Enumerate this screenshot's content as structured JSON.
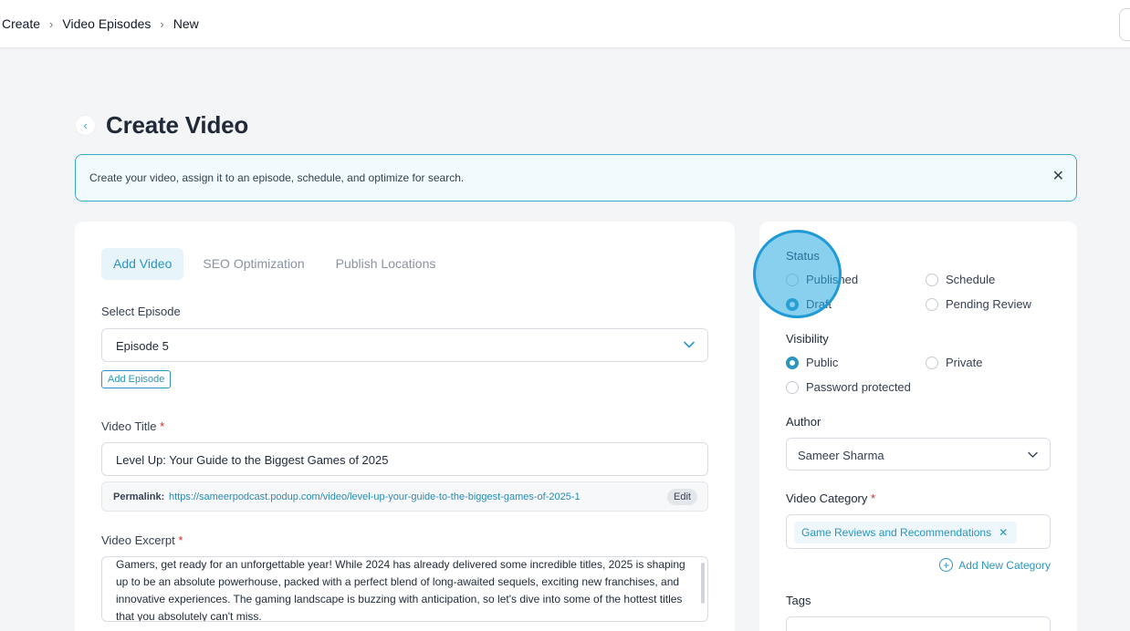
{
  "breadcrumb": [
    "Create",
    "Video Episodes",
    "New"
  ],
  "page": {
    "title": "Create Video",
    "info": "Create your video, assign it to an episode, schedule, and optimize for search."
  },
  "tabs": [
    {
      "label": "Add Video",
      "active": true
    },
    {
      "label": "SEO Optimization",
      "active": false
    },
    {
      "label": "Publish Locations",
      "active": false
    }
  ],
  "episode": {
    "label": "Select Episode",
    "value": "Episode 5",
    "add_button": "Add Episode"
  },
  "video_title": {
    "label": "Video Title",
    "value": "Level Up: Your Guide to the Biggest Games of 2025",
    "permalink_label": "Permalink:",
    "permalink_url": "https://sameerpodcast.podup.com/video/level-up-your-guide-to-the-biggest-games-of-2025-1",
    "edit_label": "Edit"
  },
  "excerpt": {
    "label": "Video Excerpt",
    "value": "Gamers, get ready for an unforgettable year! While 2024 has already delivered some incredible titles, 2025 is shaping up to be an absolute powerhouse, packed with a perfect blend of long-awaited sequels, exciting new franchises, and innovative experiences. The gaming landscape is buzzing with anticipation, so let's dive into some of the hottest titles that you absolutely can't miss."
  },
  "status": {
    "label": "Status",
    "options": [
      "Published",
      "Schedule",
      "Draft",
      "Pending Review"
    ],
    "selected": "Draft"
  },
  "visibility": {
    "label": "Visibility",
    "options": [
      "Public",
      "Private",
      "Password protected"
    ],
    "selected": "Public"
  },
  "author": {
    "label": "Author",
    "value": "Sameer Sharma"
  },
  "category": {
    "label": "Video Category",
    "chip": "Game Reviews and Recommendations",
    "add_label": "Add New Category"
  },
  "tags": {
    "label": "Tags"
  },
  "colors": {
    "accent": "#2b96c0",
    "required": "#dc2626",
    "cursor": "#1e9ad6"
  }
}
